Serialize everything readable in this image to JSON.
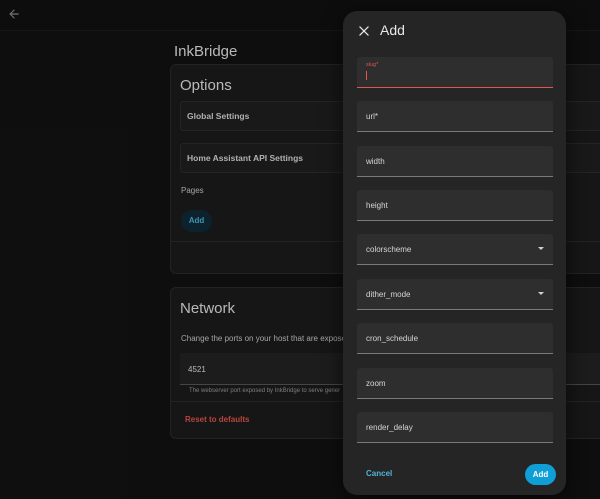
{
  "app": {
    "title": "InkBridge"
  },
  "options": {
    "title": "Options",
    "global_settings": "Global Settings",
    "ha_api_settings": "Home Assistant API Settings",
    "pages_label": "Pages",
    "add_label": "Add"
  },
  "network": {
    "title": "Network",
    "description": "Change the ports on your host that are exposed",
    "port_value": "4521",
    "port_helper": "The webserver port exposed by InkBridge to serve gener",
    "reset_label": "Reset to defaults"
  },
  "dialog": {
    "title": "Add",
    "fields": [
      {
        "label": "slug*",
        "focused": true
      },
      {
        "label": "url*"
      },
      {
        "label": "width"
      },
      {
        "label": "height"
      },
      {
        "label": "colorscheme",
        "dropdown": true
      },
      {
        "label": "dither_mode",
        "dropdown": true
      },
      {
        "label": "cron_schedule"
      },
      {
        "label": "zoom"
      },
      {
        "label": "render_delay"
      }
    ],
    "cancel_label": "Cancel",
    "add_label": "Add"
  },
  "colors": {
    "accent": "#0f9fd6",
    "error": "#e0554d",
    "background": "#121212",
    "dialog": "#252525"
  }
}
